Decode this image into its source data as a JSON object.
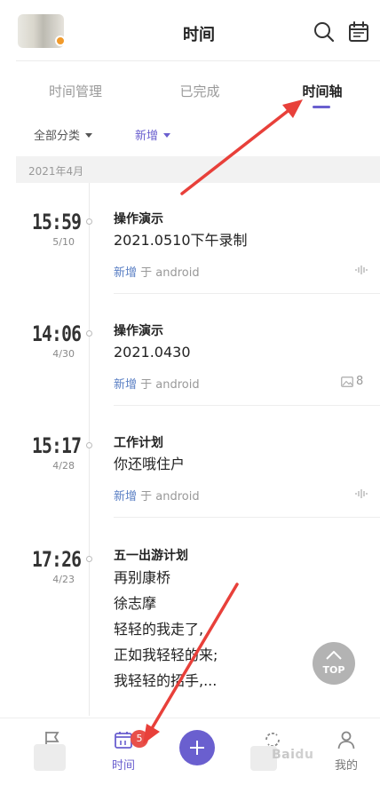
{
  "header": {
    "title": "时间"
  },
  "tabs": [
    {
      "label": "时间管理",
      "active": false
    },
    {
      "label": "已完成",
      "active": false
    },
    {
      "label": "时间轴",
      "active": true
    }
  ],
  "filters": {
    "category": "全部分类",
    "action": "新增"
  },
  "timeline": {
    "month": "2021年4月",
    "entries": [
      {
        "time": "15:59",
        "date": "5/10",
        "category": "操作演示",
        "lines": [
          "2021.0510下午录制"
        ],
        "meta_action": "新增",
        "meta_rest": " 于 android",
        "attachment": "audio"
      },
      {
        "time": "14:06",
        "date": "4/30",
        "category": "操作演示",
        "lines": [
          "2021.0430"
        ],
        "meta_action": "新增",
        "meta_rest": " 于 android",
        "attachment": "image",
        "attachment_count": "8"
      },
      {
        "time": "15:17",
        "date": "4/28",
        "category": "工作计划",
        "lines": [
          "你还哦住户"
        ],
        "meta_action": "新增",
        "meta_rest": " 于 android",
        "attachment": "audio"
      },
      {
        "time": "17:26",
        "date": "4/23",
        "category": "五一出游计划",
        "lines": [
          "再别康桥",
          "徐志摩",
          "轻轻的我走了,",
          "正如我轻轻的来;",
          "我轻轻的招手,..."
        ]
      }
    ]
  },
  "top_button": {
    "label": "TOP"
  },
  "bottom_nav": {
    "items": [
      {
        "label": "",
        "icon": "flag-icon"
      },
      {
        "label": "时间",
        "icon": "calendar-icon",
        "badge": "5"
      },
      {
        "label": "",
        "icon": "plus-icon"
      },
      {
        "label": "",
        "icon": "refresh-icon"
      },
      {
        "label": "我的",
        "icon": "user-icon"
      }
    ]
  },
  "colors": {
    "accent": "#6a5fcf",
    "badge": "#e8504a",
    "annotation": "#e8403a",
    "meta_link": "#5a7fc4"
  }
}
